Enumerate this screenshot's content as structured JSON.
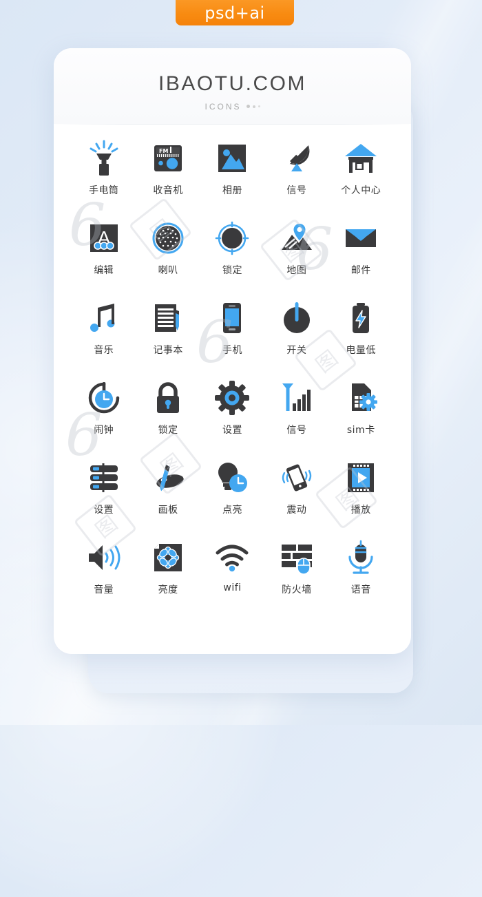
{
  "badge": {
    "label": "psd+ai",
    "color": "#f7900f"
  },
  "card": {
    "brand": "IBAOTU.COM",
    "subtitle": "ICONS"
  },
  "theme": {
    "dark": "#3a3a3c",
    "blue": "#43a7f0",
    "label": "#383838",
    "background": "#dfe9f6",
    "card": "#ffffff"
  },
  "watermark": {
    "mark": "6",
    "box_char": "图"
  },
  "icons": [
    {
      "label": "手电筒",
      "name": "flashlight"
    },
    {
      "label": "收音机",
      "name": "radio",
      "text": "FM"
    },
    {
      "label": "相册",
      "name": "photo-album"
    },
    {
      "label": "信号",
      "name": "satellite-signal"
    },
    {
      "label": "个人中心",
      "name": "personal-center"
    },
    {
      "label": "编辑",
      "name": "edit",
      "text": "A"
    },
    {
      "label": "喇叭",
      "name": "speaker"
    },
    {
      "label": "锁定",
      "name": "focus-lock"
    },
    {
      "label": "地图",
      "name": "map"
    },
    {
      "label": "邮件",
      "name": "mail"
    },
    {
      "label": "音乐",
      "name": "music"
    },
    {
      "label": "记事本",
      "name": "notepad"
    },
    {
      "label": "手机",
      "name": "mobile-phone"
    },
    {
      "label": "开关",
      "name": "power-switch"
    },
    {
      "label": "电量低",
      "name": "low-battery"
    },
    {
      "label": "闹钟",
      "name": "alarm-clock"
    },
    {
      "label": "锁定",
      "name": "padlock"
    },
    {
      "label": "设置",
      "name": "settings-gear"
    },
    {
      "label": "信号",
      "name": "signal-bars"
    },
    {
      "label": "sim卡",
      "name": "sim-card"
    },
    {
      "label": "设置",
      "name": "settings-sliders"
    },
    {
      "label": "画板",
      "name": "drawing-board"
    },
    {
      "label": "点亮",
      "name": "light-up"
    },
    {
      "label": "震动",
      "name": "vibrate"
    },
    {
      "label": "播放",
      "name": "play-film"
    },
    {
      "label": "音量",
      "name": "volume"
    },
    {
      "label": "亮度",
      "name": "brightness"
    },
    {
      "label": "wifi",
      "name": "wifi"
    },
    {
      "label": "防火墙",
      "name": "firewall"
    },
    {
      "label": "语音",
      "name": "voice-microphone"
    }
  ]
}
